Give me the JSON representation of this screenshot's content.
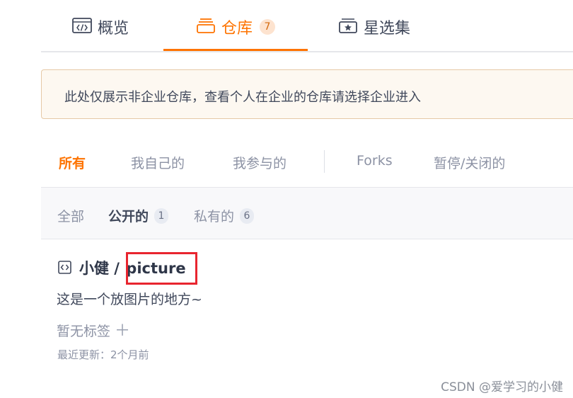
{
  "tabs": {
    "overview_label": "概览",
    "repos_label": "仓库",
    "repos_count": "7",
    "stars_label": "星选集"
  },
  "notice": {
    "text": "此处仅展示非企业仓库，查看个人在企业的仓库请选择企业进入"
  },
  "owner_filters": [
    "所有",
    "我自己的",
    "我参与的",
    "Forks",
    "暂停/关闭的"
  ],
  "visibility": {
    "all_label": "全部",
    "public_label": "公开的",
    "public_count": "1",
    "private_label": "私有的",
    "private_count": "6"
  },
  "repo": {
    "owner": "小健",
    "separator": " / ",
    "name": "picture",
    "description": "这是一个放图片的地方~",
    "tags_placeholder": "暂无标签",
    "add_tag_symbol": "＋",
    "updated": "最近更新：2个月前"
  },
  "watermark": "CSDN @爱学习的小健",
  "colors": {
    "accent": "#fe7300",
    "highlight_box": "#e8252f",
    "notice_bg": "#fdf8f1",
    "notice_border": "#e6c9a6"
  },
  "icons": {
    "overview": "code-window-icon",
    "repos": "stack-icon",
    "stars": "star-box-icon",
    "repo": "code-box-icon"
  }
}
